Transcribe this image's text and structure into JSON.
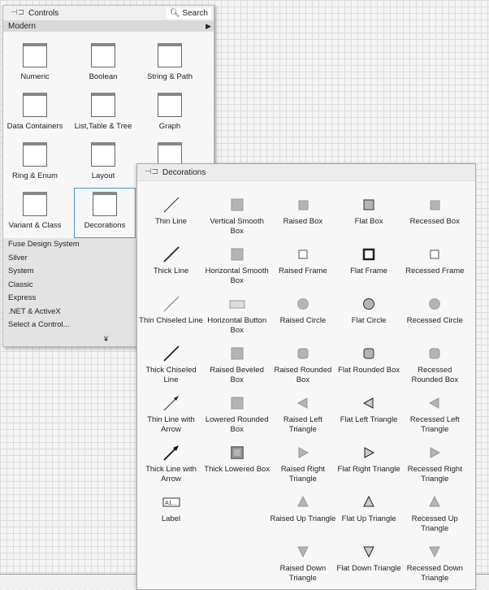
{
  "controls": {
    "title": "Controls",
    "search_label": "Search",
    "current_palette": "Modern",
    "categories": [
      {
        "label": "Numeric",
        "icon": "numeric-icon"
      },
      {
        "label": "Boolean",
        "icon": "boolean-icon"
      },
      {
        "label": "String & Path",
        "icon": "string-path-icon"
      },
      {
        "label": "Data Containers",
        "icon": "data-containers-icon"
      },
      {
        "label": "List,Table & Tree",
        "icon": "list-table-tree-icon"
      },
      {
        "label": "Graph",
        "icon": "graph-icon"
      },
      {
        "label": "Ring & Enum",
        "icon": "ring-enum-icon"
      },
      {
        "label": "Layout",
        "icon": "layout-icon"
      },
      {
        "label": "",
        "icon": "io-icon"
      },
      {
        "label": "Variant & Class",
        "icon": "variant-class-icon"
      },
      {
        "label": "Decorations",
        "icon": "decorations-icon",
        "selected": true
      }
    ],
    "palettes": [
      "Fuse Design System",
      "Silver",
      "System",
      "Classic",
      "Express",
      ".NET & ActiveX",
      "Select a Control..."
    ]
  },
  "decorations": {
    "title": "Decorations",
    "items": [
      {
        "label": "Thin Line",
        "shape": "line1"
      },
      {
        "label": "Vertical Smooth Box",
        "shape": "box"
      },
      {
        "label": "Raised Box",
        "shape": "sbox"
      },
      {
        "label": "Flat Box",
        "shape": "fbox"
      },
      {
        "label": "Recessed Box",
        "shape": "sbox"
      },
      {
        "label": "Thick Line",
        "shape": "line2"
      },
      {
        "label": "Horizontal Smooth Box",
        "shape": "box"
      },
      {
        "label": "Raised Frame",
        "shape": "frame"
      },
      {
        "label": "Flat Frame",
        "shape": "fframe"
      },
      {
        "label": "Recessed Frame",
        "shape": "frame"
      },
      {
        "label": "Thin Chiseled Line",
        "shape": "line0"
      },
      {
        "label": "Horizontal Button Box",
        "shape": "hbtn"
      },
      {
        "label": "Raised Circle",
        "shape": "circle"
      },
      {
        "label": "Flat Circle",
        "shape": "fcircle"
      },
      {
        "label": "Recessed Circle",
        "shape": "circle"
      },
      {
        "label": "Thick Chiseled Line",
        "shape": "line2"
      },
      {
        "label": "Raised Beveled Box",
        "shape": "box"
      },
      {
        "label": "Raised Rounded Box",
        "shape": "rbox"
      },
      {
        "label": "Flat Rounded Box",
        "shape": "frbox"
      },
      {
        "label": "Recessed Rounded Box",
        "shape": "rbox"
      },
      {
        "label": "Thin Line with Arrow",
        "shape": "arrow1"
      },
      {
        "label": "Lowered Rounded Box",
        "shape": "box"
      },
      {
        "label": "Raised Left Triangle",
        "shape": "tl"
      },
      {
        "label": "Flat Left Triangle",
        "shape": "ftl"
      },
      {
        "label": "Recessed Left Triangle",
        "shape": "tl"
      },
      {
        "label": "Thick Line with Arrow",
        "shape": "arrow2"
      },
      {
        "label": "Thick Lowered Box",
        "shape": "tlbox"
      },
      {
        "label": "Raised Right Triangle",
        "shape": "tr"
      },
      {
        "label": "Flat Right Triangle",
        "shape": "ftr"
      },
      {
        "label": "Recessed Right Triangle",
        "shape": "tr"
      },
      {
        "label": "Label",
        "shape": "label"
      },
      null,
      {
        "label": "Raised Up Triangle",
        "shape": "tu"
      },
      {
        "label": "Flat Up Triangle",
        "shape": "ftu"
      },
      {
        "label": "Recessed Up Triangle",
        "shape": "tu"
      },
      null,
      null,
      {
        "label": "Raised Down Triangle",
        "shape": "td"
      },
      {
        "label": "Flat Down Triangle",
        "shape": "ftd"
      },
      {
        "label": "Recessed Down Triangle",
        "shape": "td"
      }
    ],
    "label_icon_text": "A1..."
  }
}
